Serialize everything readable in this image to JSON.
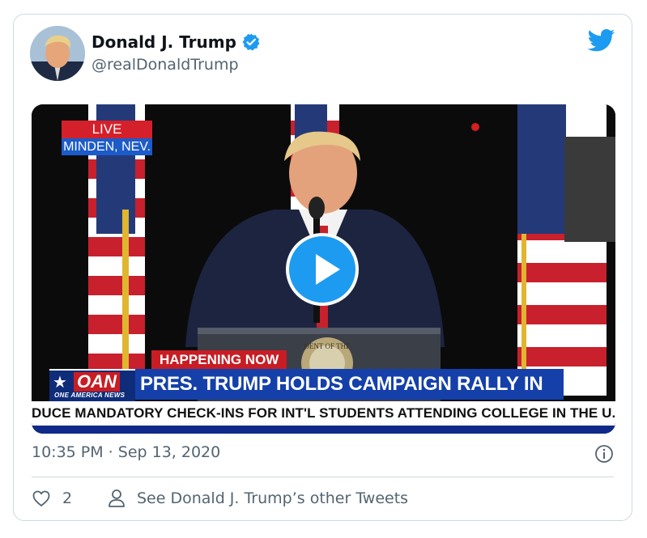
{
  "tweet": {
    "author": {
      "display_name": "Donald J. Trump",
      "handle": "@realDonaldTrump",
      "verified": true
    },
    "timestamp": "10:35 PM · Sep 13, 2020",
    "like_count": "2",
    "profile_link": "See Donald J. Trump’s other Tweets"
  },
  "video": {
    "live_label": "LIVE",
    "location_label": "MINDEN, NEV.",
    "happening_label": "HAPPENING NOW",
    "network_logo": "OAN",
    "network_subtitle": "ONE AMERICA NEWS",
    "headline": "PRES. TRUMP HOLDS CAMPAIGN RALLY IN NEVADA",
    "ticker": "DUCE MANDATORY CHECK-INS FOR INT'L STUDENTS ATTENDING COLLEGE IN THE U.S",
    "podium_seal_text": "DENT OF THE"
  },
  "colors": {
    "accent": "#1d9bf0",
    "text_primary": "#0f1419",
    "text_secondary": "#536471",
    "border": "#cfd9de"
  },
  "icons": {
    "brand": "twitter-bird-icon",
    "verified": "verified-badge-icon",
    "play": "play-icon",
    "info": "info-icon",
    "like": "heart-icon",
    "profile": "person-icon"
  }
}
